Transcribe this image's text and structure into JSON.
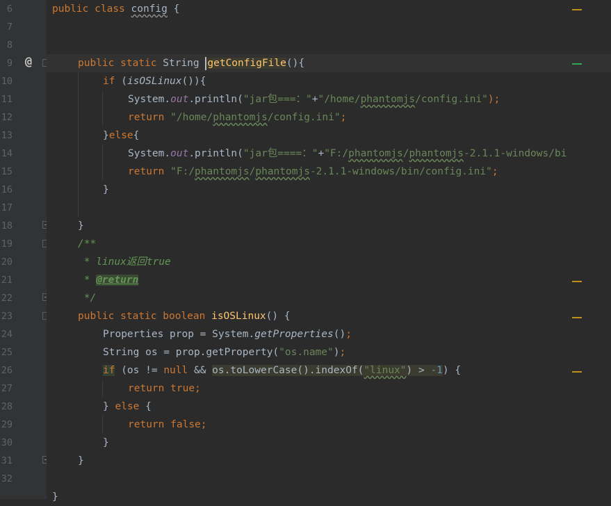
{
  "line_numbers": [
    "6",
    "7",
    "8",
    "9",
    "10",
    "11",
    "12",
    "13",
    "14",
    "15",
    "16",
    "17",
    "18",
    "19",
    "20",
    "21",
    "22",
    "23",
    "24",
    "25",
    "26",
    "27",
    "28",
    "29",
    "30",
    "31",
    "32"
  ],
  "code": {
    "l6": {
      "kw1": "public",
      "kw2": "class",
      "name": "config",
      "brace": "{"
    },
    "l9": {
      "kw1": "public",
      "kw2": "static",
      "type": "String",
      "fn": "getConfigFile",
      "rest": "(){"
    },
    "l10": {
      "kw": "if",
      "open": "(",
      "call": "isOSLinux",
      "rest": "()){"
    },
    "l11": {
      "cls": "System.",
      "fld": "out",
      "mid": ".println(",
      "s1": "\"jar包===：\"",
      "plus": "+",
      "s2a": "\"/home/",
      "s2b": "phantomjs",
      "s2c": "/config.ini\"",
      "end": ");"
    },
    "l12": {
      "kw": "return",
      "s1": "\"/home/",
      "s2": "phantomjs",
      "s3": "/config.ini\"",
      "end": ";"
    },
    "l13": {
      "brace": "}",
      "kw": "else",
      "open": "{"
    },
    "l14": {
      "cls": "System.",
      "fld": "out",
      "mid": ".println(",
      "s1": "\"jar包====：\"",
      "plus": "+",
      "s2a": "\"F:/",
      "s2b": "phantomjs",
      "s2c": "/",
      "s2d": "phantomjs",
      "s2e": "-2.1.1-windows/bi"
    },
    "l15": {
      "kw": "return",
      "s1": "\"F:/",
      "s2": "phantomjs",
      "s3": "/",
      "s4": "phantomjs",
      "s5": "-2.1.1-windows/bin/config.ini\"",
      "end": ";"
    },
    "l16": {
      "brace": "}"
    },
    "l18": {
      "brace": "}"
    },
    "l19": {
      "text": "/**"
    },
    "l20": {
      "star": " * ",
      "text": "linux返回",
      "tag": "true"
    },
    "l21": {
      "star": " * ",
      "tag": "@return"
    },
    "l22": {
      "text": " */"
    },
    "l23": {
      "kw1": "public",
      "kw2": "static",
      "kw3": "boolean",
      "fn": "isOSLinux",
      "rest": "() {"
    },
    "l24": {
      "a": "Properties prop = System.",
      "call": "getProperties",
      "b": "()",
      "end": ";"
    },
    "l25": {
      "a": "String os = prop.getProperty(",
      "s": "\"os.name\"",
      "b": ")",
      "end": ";"
    },
    "l26": {
      "kw": "if",
      "a": " (os != ",
      "kw2": "null",
      "b": " && ",
      "c": "os.toLowerCase().indexOf(",
      "s": "\"linux\"",
      "d": ") > ",
      "n": "-1",
      "e": ") {"
    },
    "l27": {
      "kw": "return",
      "kw2": "true",
      "end": ";"
    },
    "l28": {
      "a": "} ",
      "kw": "else",
      "b": " {"
    },
    "l29": {
      "kw": "return",
      "kw2": "false",
      "end": ";"
    },
    "l30": {
      "brace": "}"
    },
    "l31": {
      "brace": "}"
    },
    "l33": {
      "brace": "}"
    }
  },
  "gutter": {
    "at_symbol": "@"
  },
  "colors": {
    "keyword": "#cc7832",
    "string": "#6a8759",
    "function": "#ffc66d",
    "field": "#9876aa",
    "number": "#6897bb",
    "comment": "#629755",
    "text": "#a9b7c6",
    "background": "#2b2b2b",
    "gutter": "#313335",
    "line_number": "#606366"
  }
}
